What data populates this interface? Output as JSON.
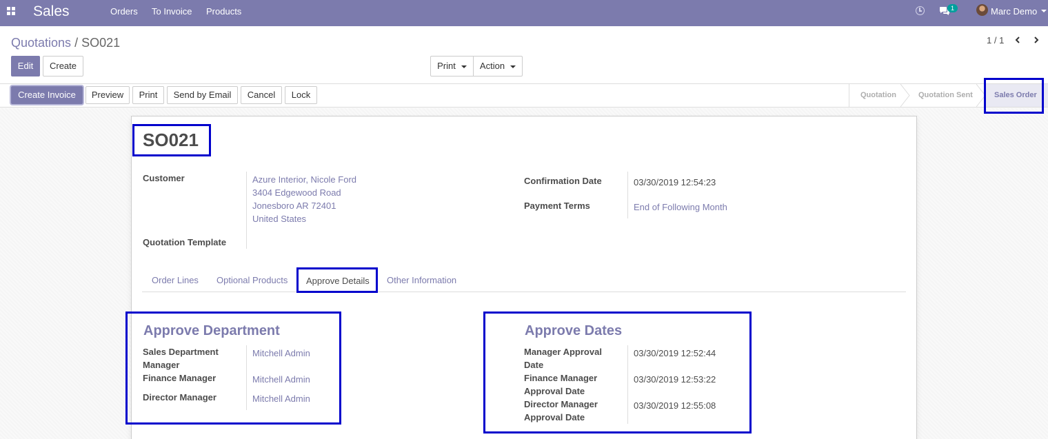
{
  "navbar": {
    "app_name": "Sales",
    "menu": [
      "Orders",
      "To Invoice",
      "Products"
    ],
    "chat_count": "1",
    "user": "Marc Demo",
    "bg_color": "#7c7bad"
  },
  "breadcrumb": {
    "parent": "Quotations",
    "separator": "/",
    "current": "SO021"
  },
  "buttons": {
    "edit": "Edit",
    "create": "Create",
    "print": "Print",
    "action": "Action"
  },
  "pager": {
    "value": "1 / 1"
  },
  "statusbar": {
    "actions": [
      "Create Invoice",
      "Preview",
      "Print",
      "Send by Email",
      "Cancel",
      "Lock"
    ],
    "stages": [
      "Quotation",
      "Quotation Sent",
      "Sales Order"
    ],
    "active_stage": "Sales Order"
  },
  "record": {
    "name": "SO021",
    "customer_label": "Customer",
    "customer_lines": [
      "Azure Interior, Nicole Ford",
      "3404 Edgewood Road",
      "Jonesboro AR 72401",
      "United States"
    ],
    "quotation_template_label": "Quotation Template",
    "confirmation_date_label": "Confirmation Date",
    "confirmation_date": "03/30/2019 12:54:23",
    "payment_terms_label": "Payment Terms",
    "payment_terms": "End of Following Month"
  },
  "tabs": [
    "Order Lines",
    "Optional Products",
    "Approve Details",
    "Other Information"
  ],
  "active_tab": "Approve Details",
  "approve_department": {
    "title": "Approve Department",
    "rows": [
      {
        "label_1": "Sales Department",
        "label_2": "Manager",
        "value": "Mitchell Admin"
      },
      {
        "label_1": "Finance Manager",
        "label_2": "",
        "value": "Mitchell Admin"
      },
      {
        "label_1": "Director Manager",
        "label_2": "",
        "value": "Mitchell Admin"
      }
    ]
  },
  "approve_dates": {
    "title": "Approve Dates",
    "rows": [
      {
        "label_1": "Manager Approval",
        "label_2": "Date",
        "value": "03/30/2019 12:52:44"
      },
      {
        "label_1": "Finance Manager",
        "label_2": "Approval Date",
        "value": "03/30/2019 12:53:22"
      },
      {
        "label_1": "Director Manager",
        "label_2": "Approval Date",
        "value": "03/30/2019 12:55:08"
      }
    ]
  },
  "highlight_color": "#0000cc"
}
